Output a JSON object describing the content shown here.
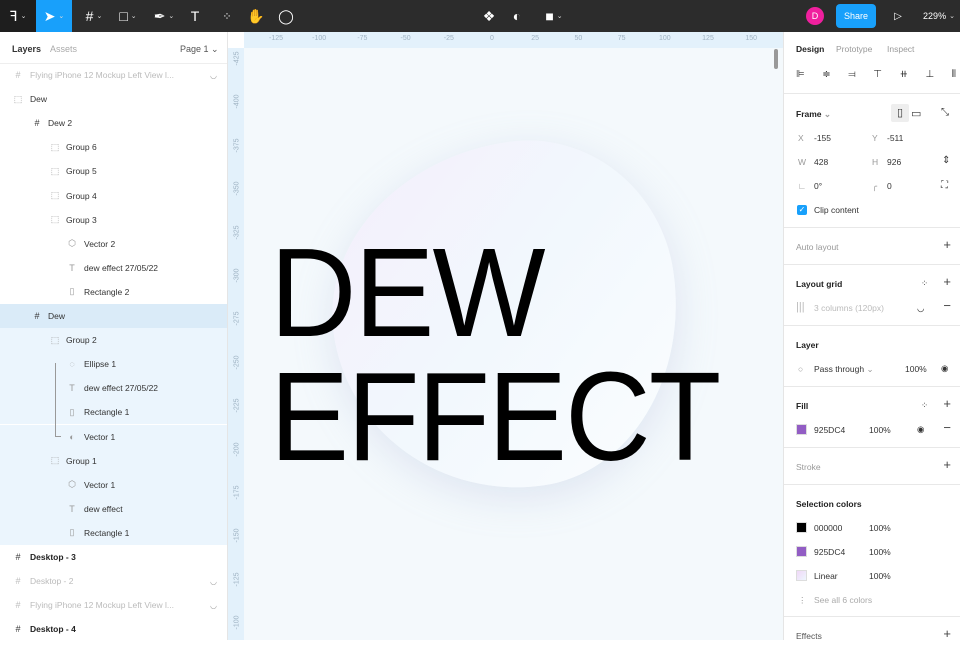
{
  "toolbar": {
    "zoom": "229%",
    "share": "Share",
    "avatar": "D",
    "accent": "#18a0fb"
  },
  "left": {
    "tabs": [
      "Layers",
      "Assets"
    ],
    "page": "Page 1",
    "layers": [
      {
        "label": "Flying iPhone 12 Mockup Left View l...",
        "level": 0,
        "icon": "frame",
        "style": "dim",
        "hidden": true
      },
      {
        "label": "Dew",
        "level": 0,
        "icon": "group"
      },
      {
        "label": "Dew 2",
        "level": 1,
        "icon": "frame"
      },
      {
        "label": "Group 6",
        "level": 2,
        "icon": "group"
      },
      {
        "label": "Group 5",
        "level": 2,
        "icon": "group"
      },
      {
        "label": "Group 4",
        "level": 2,
        "icon": "group"
      },
      {
        "label": "Group 3",
        "level": 2,
        "icon": "group"
      },
      {
        "label": "Vector 2",
        "level": 3,
        "icon": "vector"
      },
      {
        "label": "dew effect 27/05/22",
        "level": 3,
        "icon": "text"
      },
      {
        "label": "Rectangle 2",
        "level": 3,
        "icon": "rect"
      },
      {
        "label": "Dew",
        "level": 1,
        "icon": "frame",
        "style": "selected"
      },
      {
        "label": "Group 2",
        "level": 2,
        "icon": "group",
        "style": "child"
      },
      {
        "label": "Ellipse 1",
        "level": 3,
        "icon": "ellipse",
        "style": "child"
      },
      {
        "label": "dew effect 27/05/22",
        "level": 3,
        "icon": "text",
        "style": "child"
      },
      {
        "label": "Rectangle 1",
        "level": 3,
        "icon": "rect",
        "style": "child"
      },
      {
        "label": "Vector 1",
        "level": 3,
        "icon": "mask",
        "style": "child"
      },
      {
        "label": "Group 1",
        "level": 2,
        "icon": "group",
        "style": "child"
      },
      {
        "label": "Vector 1",
        "level": 3,
        "icon": "vector",
        "style": "child"
      },
      {
        "label": "dew effect",
        "level": 3,
        "icon": "text",
        "style": "child"
      },
      {
        "label": "Rectangle 1",
        "level": 3,
        "icon": "rect",
        "style": "child"
      },
      {
        "label": "Desktop - 3",
        "level": 0,
        "icon": "frame",
        "style": "bold"
      },
      {
        "label": "Desktop - 2",
        "level": 0,
        "icon": "frame",
        "style": "dim",
        "hidden": true
      },
      {
        "label": "Flying iPhone 12 Mockup Left View l...",
        "level": 0,
        "icon": "frame",
        "style": "dim",
        "hidden": true
      },
      {
        "label": "Desktop - 4",
        "level": 0,
        "icon": "frame",
        "style": "bold"
      }
    ]
  },
  "canvas": {
    "hticks": [
      "-125",
      "-100",
      "-75",
      "-50",
      "-25",
      "0",
      "25",
      "50",
      "75",
      "100",
      "125",
      "150"
    ],
    "vticks": [
      "-425",
      "-400",
      "-375",
      "-350",
      "-325",
      "-300",
      "-275",
      "-250",
      "-225",
      "-200",
      "-175",
      "-150",
      "-125",
      "-100"
    ],
    "line1": "DEW",
    "line2": "EFFECT"
  },
  "right": {
    "tabs": [
      "Design",
      "Prototype",
      "Inspect"
    ],
    "frame": {
      "title": "Frame",
      "x_label": "X",
      "x": "-155",
      "y_label": "Y",
      "y": "-511",
      "w_label": "W",
      "w": "428",
      "h_label": "H",
      "h": "926",
      "rotation": "0°",
      "radius": "0",
      "clip": "Clip content"
    },
    "auto_layout": "Auto layout",
    "layout_grid": {
      "title": "Layout grid",
      "item": "3 columns (120px)"
    },
    "layer": {
      "title": "Layer",
      "blend": "Pass through",
      "opacity": "100%"
    },
    "fill": {
      "title": "Fill",
      "hex": "925DC4",
      "opacity": "100%",
      "color": "#925dc4"
    },
    "stroke": "Stroke",
    "selection": {
      "title": "Selection colors",
      "items": [
        {
          "name": "000000",
          "opacity": "100%",
          "color": "#000000"
        },
        {
          "name": "925DC4",
          "opacity": "100%",
          "color": "#925dc4"
        },
        {
          "name": "Linear",
          "opacity": "100%",
          "color": "linear-gradient(135deg,#f0d8f8,#eef6fd)"
        }
      ],
      "see_all": "See all 6 colors"
    },
    "effects": "Effects"
  }
}
